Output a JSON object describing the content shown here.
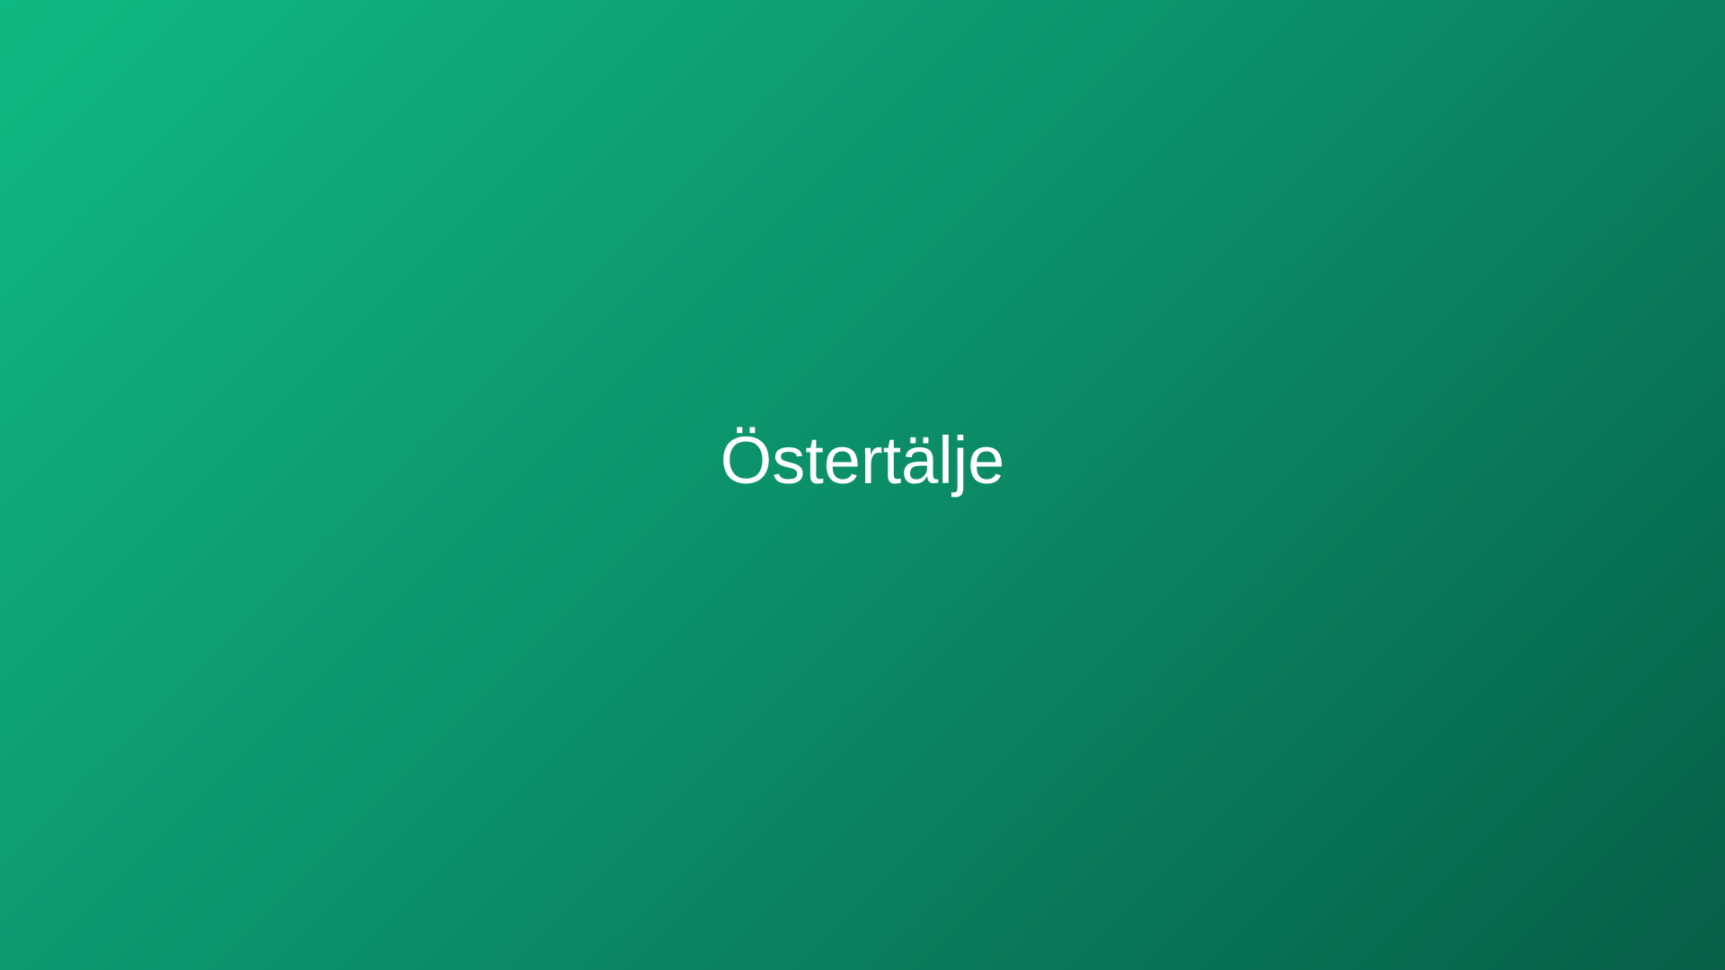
{
  "screen": {
    "title": "Östertälje"
  },
  "colors": {
    "gradient_start": "#10b981",
    "gradient_mid": "#0b8e68",
    "gradient_end": "#065f46",
    "text": "#ffffff"
  }
}
